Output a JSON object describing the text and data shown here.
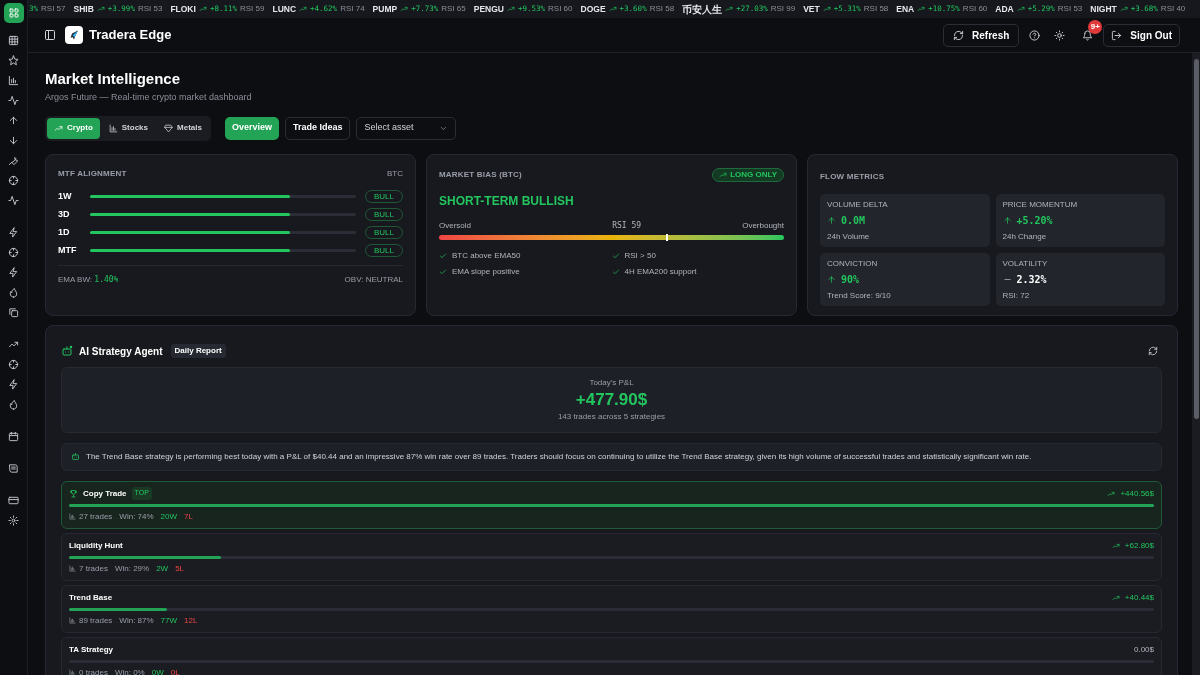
{
  "ticker": [
    {
      "change": "3%",
      "rsi": "RSI 57"
    },
    {
      "symbol": "SHIB",
      "change": "+3.99%",
      "rsi": "RSI 53"
    },
    {
      "symbol": "FLOKI",
      "change": "+8.11%",
      "rsi": "RSI 59"
    },
    {
      "symbol": "LUNC",
      "change": "+4.62%",
      "rsi": "RSI 74"
    },
    {
      "symbol": "PUMP",
      "change": "+7.73%",
      "rsi": "RSI 65"
    },
    {
      "symbol": "PENGU",
      "change": "+9.53%",
      "rsi": "RSI 60"
    },
    {
      "symbol": "DOGE",
      "change": "+3.60%",
      "rsi": "RSI 58"
    },
    {
      "symbol": "币安人生",
      "change": "+27.03%",
      "rsi": "RSI 99"
    },
    {
      "symbol": "VET",
      "change": "+5.31%",
      "rsi": "RSI 58"
    },
    {
      "symbol": "ENA",
      "change": "+10.75%",
      "rsi": "RSI 60"
    },
    {
      "symbol": "ADA",
      "change": "+5.29%",
      "rsi": "RSI 53"
    },
    {
      "symbol": "NIGHT",
      "change": "+3.68%",
      "rsi": "RSI 40"
    }
  ],
  "header": {
    "app_name": "Tradera Edge",
    "refresh": "Refresh",
    "notifications": "9+",
    "sign_out": "Sign Out"
  },
  "page": {
    "title": "Market Intelligence",
    "subtitle": "Argos Future — Real-time crypto market dashboard"
  },
  "market_tabs": [
    {
      "label": "Crypto",
      "kind": "trend",
      "selected": true
    },
    {
      "label": "Stocks",
      "kind": "bars",
      "selected": false
    },
    {
      "label": "Metals",
      "kind": "gem",
      "selected": false
    }
  ],
  "view_tabs": [
    {
      "label": "Overview",
      "selected": true
    },
    {
      "label": "Trade Ideas",
      "selected": false
    }
  ],
  "asset_select": {
    "placeholder": "Select asset"
  },
  "mtf": {
    "title": "MTF ALIGNMENT",
    "asset": "BTC",
    "rows": [
      {
        "label": "1W",
        "level": 0.75,
        "signal": "BULL"
      },
      {
        "label": "3D",
        "level": 0.75,
        "signal": "BULL"
      },
      {
        "label": "1D",
        "level": 0.75,
        "signal": "BULL"
      },
      {
        "label": "MTF",
        "level": 0.75,
        "signal": "BULL"
      }
    ],
    "ema_label": "EMA BW:",
    "ema_value": "1.40%",
    "obv": "OBV: NEUTRAL"
  },
  "bias": {
    "title": "MARKET BIAS (BTC)",
    "badge": "LONG ONLY",
    "headline": "SHORT-TERM BULLISH",
    "low_label": "Oversold",
    "rsi_label": "RSI 59",
    "high_label": "Overbought",
    "level": 0.657,
    "checks": [
      {
        "text": "BTC above EMA50"
      },
      {
        "text": "RSI > 50"
      },
      {
        "text": "EMA slope positive"
      },
      {
        "text": "4H EMA200 support"
      }
    ]
  },
  "flow": {
    "title": "FLOW METRICS",
    "metrics": [
      {
        "label": "VOLUME DELTA",
        "value": "0.0M",
        "kind": "up",
        "note": "24h Volume"
      },
      {
        "label": "PRICE MOMENTUM",
        "value": "+5.20%",
        "kind": "up",
        "note": "24h Change"
      },
      {
        "label": "CONVICTION",
        "value": "90%",
        "kind": "up",
        "note": "Trend Score: 9/10"
      },
      {
        "label": "VOLATILITY",
        "value": "2.32%",
        "kind": "flat",
        "note": "RSI: 72"
      }
    ]
  },
  "agent": {
    "title": "AI Strategy Agent",
    "badge": "Daily Report",
    "pnl_label": "Today's P&L",
    "pnl_value": "+477.90$",
    "pnl_note": "143 trades across 5 strategies",
    "summary": "The Trend Base strategy is performing best today with a P&L of $40.44 and an impressive 87% win rate over 89 trades. Traders should focus on continuing to utilize the Trend Base strategy, given its high volume of successful trades and statistically significant win rate.",
    "strategies": [
      {
        "name": "Copy Trade",
        "top": true,
        "top_label": "TOP",
        "pnl": "+440.56$",
        "positive": true,
        "level": 1.0,
        "trades": "27 trades",
        "win": "Win: 74%",
        "wins": "20W",
        "losses": "7L"
      },
      {
        "name": "Liquidity Hunt",
        "top": false,
        "pnl": "+62.80$",
        "positive": true,
        "level": 0.14,
        "trades": "7 trades",
        "win": "Win: 29%",
        "wins": "2W",
        "losses": "5L"
      },
      {
        "name": "Trend Base",
        "top": false,
        "pnl": "+40.44$",
        "positive": true,
        "level": 0.09,
        "trades": "89 trades",
        "win": "Win: 87%",
        "wins": "77W",
        "losses": "12L"
      },
      {
        "name": "TA Strategy",
        "top": false,
        "pnl": "0.00$",
        "positive": false,
        "level": 0,
        "trades": "0 trades",
        "win": "Win: 0%",
        "wins": "0W",
        "losses": "0L"
      }
    ]
  }
}
